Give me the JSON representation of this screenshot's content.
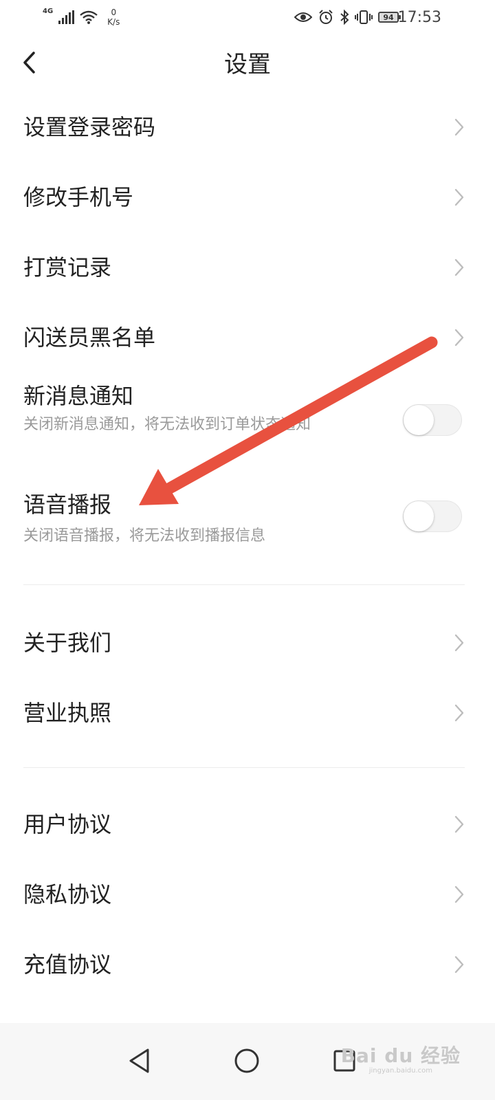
{
  "status_bar": {
    "network_type": "4G",
    "speed_value": "0",
    "speed_unit": "K/s",
    "battery_level": "94",
    "time": "17:53",
    "icons": [
      "signal-icon",
      "wifi-icon",
      "eye-icon",
      "alarm-icon",
      "bluetooth-icon",
      "vibrate-icon",
      "battery-icon"
    ]
  },
  "header": {
    "title": "设置",
    "back_icon": "chevron-left-icon"
  },
  "settings": {
    "items_a": [
      {
        "label": "设置登录密码"
      },
      {
        "label": "修改手机号"
      },
      {
        "label": "打赏记录"
      },
      {
        "label": "闪送员黑名单"
      }
    ],
    "new_message": {
      "title": "新消息通知",
      "description": "关闭新消息通知，将无法收到订单状态通知",
      "enabled": false
    },
    "voice_broadcast": {
      "title": "语音播报",
      "description": "关闭语音播报，将无法收到播报信息",
      "enabled": false
    },
    "items_b": [
      {
        "label": "关于我们"
      },
      {
        "label": "营业执照"
      }
    ],
    "items_c": [
      {
        "label": "用户协议"
      },
      {
        "label": "隐私协议"
      },
      {
        "label": "充值协议"
      }
    ]
  },
  "annotation": {
    "arrow_color": "#e8513f"
  },
  "navigation_bar": {
    "buttons": [
      "back-triangle-icon",
      "home-circle-icon",
      "recents-square-icon"
    ]
  },
  "watermark": {
    "brand": "Bai du 经验",
    "url": "jingyan.baidu.com"
  }
}
